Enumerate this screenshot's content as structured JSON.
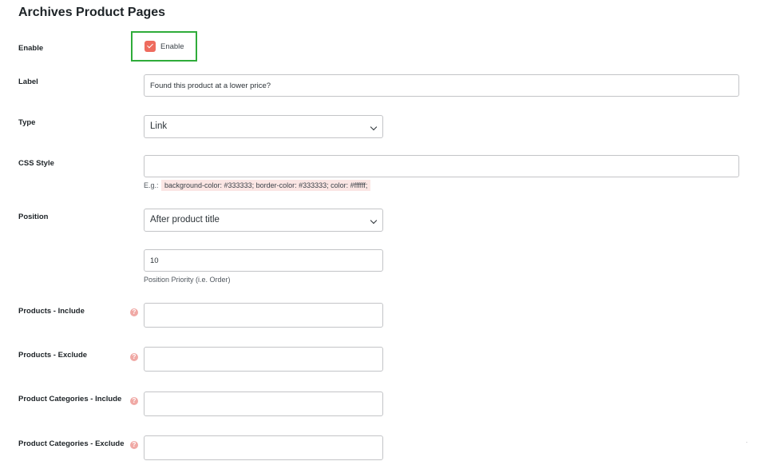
{
  "section": {
    "title": "Archives Product Pages"
  },
  "enable": {
    "label": "Enable",
    "checkbox_label": "Enable",
    "checked": true
  },
  "label_field": {
    "label": "Label",
    "value": "Found this product at a lower price?"
  },
  "type_field": {
    "label": "Type",
    "value": "Link"
  },
  "css_style": {
    "label": "CSS Style",
    "value": "",
    "hint_prefix": "E.g.:",
    "example": "background-color: #333333; border-color: #333333; color: #ffffff;"
  },
  "position": {
    "label": "Position",
    "value": "After product title",
    "priority_value": "10",
    "priority_hint": "Position Priority (i.e. Order)"
  },
  "products_include": {
    "label": "Products - Include",
    "value": ""
  },
  "products_exclude": {
    "label": "Products - Exclude",
    "value": ""
  },
  "categories_include": {
    "label": "Product Categories - Include",
    "value": ""
  },
  "categories_exclude": {
    "label": "Product Categories - Exclude",
    "value": ""
  },
  "help_icon_glyph": "?",
  "colors": {
    "accent": "#ee6b5e",
    "highlight": "#2fac3a",
    "code_bg": "#fbe6e4",
    "help_icon": "#f0a9a5"
  }
}
